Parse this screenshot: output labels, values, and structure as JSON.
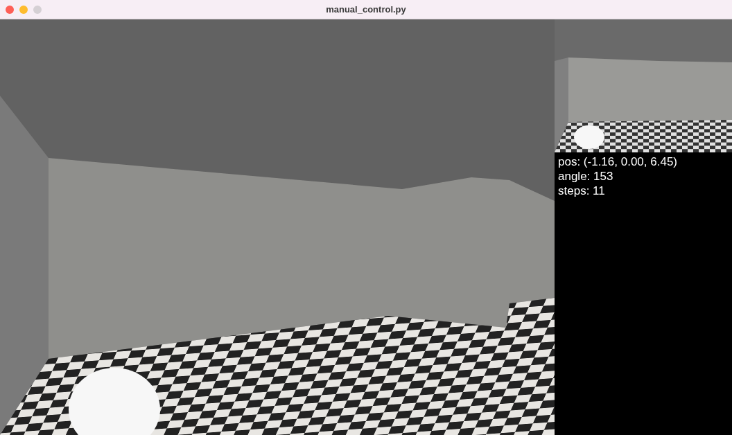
{
  "window": {
    "title": "manual_control.py"
  },
  "info": {
    "lines": [
      "pos: (-1.16, 0.00, 6.45)",
      "angle: 153",
      "steps: 11"
    ]
  }
}
